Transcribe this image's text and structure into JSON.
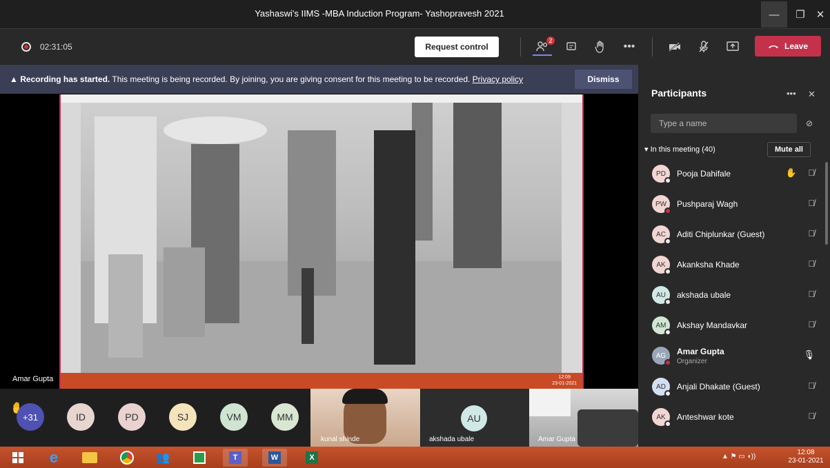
{
  "window": {
    "title": "Yashaswi's IIMS -MBA Induction Program- Yashopravesh 2021",
    "min": "—",
    "max": "❐",
    "close": "✕"
  },
  "toolbar": {
    "timer": "02:31:05",
    "request_control": "Request control",
    "people_badge": "2",
    "leave": "Leave"
  },
  "banner": {
    "bold": "Recording has started.",
    "text": " This meeting is being recorded. By joining, you are giving consent for this meeting to be recorded. ",
    "link": "Privacy policy",
    "dismiss": "Dismiss"
  },
  "stage": {
    "presenter_name": "Amar Gupta",
    "inner_clock": "12:09",
    "inner_date": "23-01-2021"
  },
  "strip": {
    "overflow": "+31",
    "avatars": [
      {
        "initials": "ID",
        "color": "#e6d6cf"
      },
      {
        "initials": "PD",
        "color": "#e9d2cf"
      },
      {
        "initials": "SJ",
        "color": "#f4e4bc"
      },
      {
        "initials": "VM",
        "color": "#cfe5d2"
      },
      {
        "initials": "MM",
        "color": "#d8e6d2"
      }
    ],
    "tile_names": [
      "kunal shinde",
      "akshada ubale",
      "Amar Gupta"
    ],
    "au_initials": "AU"
  },
  "panel": {
    "title": "Participants",
    "search_placeholder": "Type a name",
    "in_meeting": "In this meeting (40)",
    "mute_all": "Mute all",
    "participants": [
      {
        "initials": "PD",
        "name": "Pooja Dahifale",
        "color": "#f2d6d3"
      },
      {
        "initials": "PW",
        "name": "Pushparaj Wagh",
        "color": "#f2d6d3"
      },
      {
        "initials": "AC",
        "name": "Aditi Chiplunkar (Guest)",
        "color": "#f2d6d3"
      },
      {
        "initials": "AK",
        "name": "Akanksha Khade",
        "color": "#f2d6d3"
      },
      {
        "initials": "AU",
        "name": "akshada ubale",
        "color": "#d0e8e6"
      },
      {
        "initials": "AM",
        "name": "Akshay Mandavkar",
        "color": "#cfe6d3"
      },
      {
        "initials": "AG",
        "name": "Amar Gupta",
        "sub": "Organizer",
        "color": "#9aa6b8"
      },
      {
        "initials": "AD",
        "name": "Anjali Dhakate (Guest)",
        "color": "#d3dff2"
      },
      {
        "initials": "AK",
        "name": "Anteshwar kote",
        "color": "#f2d6d3"
      }
    ]
  },
  "taskbar": {
    "time": "12:08",
    "date": "23-01-2021"
  }
}
